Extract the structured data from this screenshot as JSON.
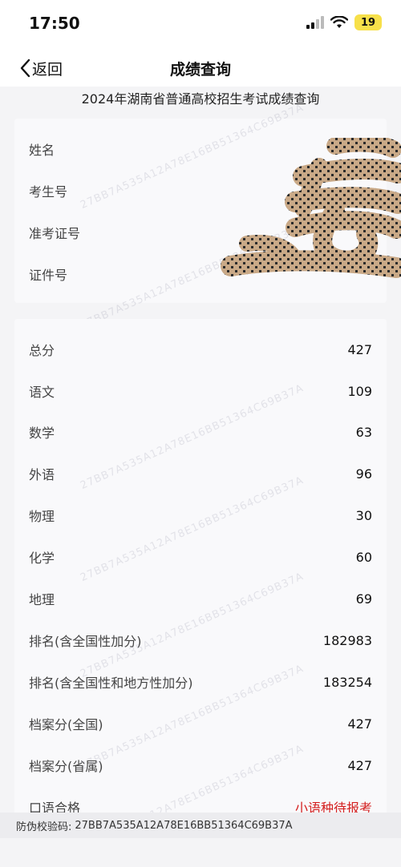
{
  "status_bar": {
    "time": "17:50",
    "battery": "19"
  },
  "nav": {
    "back_label": "返回",
    "title": "成绩查询"
  },
  "subtitle": "2024年湖南省普通高校招生考试成绩查询",
  "personal_info": [
    {
      "label": "姓名"
    },
    {
      "label": "考生号"
    },
    {
      "label": "准考证号"
    },
    {
      "label": "证件号"
    }
  ],
  "scores": [
    {
      "label": "总分",
      "value": "427"
    },
    {
      "label": "语文",
      "value": "109"
    },
    {
      "label": "数学",
      "value": "63"
    },
    {
      "label": "外语",
      "value": "96"
    },
    {
      "label": "物理",
      "value": "30"
    },
    {
      "label": "化学",
      "value": "60"
    },
    {
      "label": "地理",
      "value": "69"
    },
    {
      "label": "排名(含全国性加分)",
      "value": "182983"
    },
    {
      "label": "排名(含全国性和地方性加分)",
      "value": "183254"
    },
    {
      "label": "档案分(全国)",
      "value": "427"
    },
    {
      "label": "档案分(省属)",
      "value": "427"
    },
    {
      "label": "口语合格",
      "value": "小语种待报考"
    }
  ],
  "watermark": "27BB7A535A12A78E16BB51364C69B37A",
  "footer": {
    "label": "防伪校验码:",
    "code": "27BB7A535A12A78E16BB51364C69B37A"
  },
  "colors": {
    "accent_red": "#d42020",
    "battery": "#f7e04a",
    "redaction": "#c9a987"
  }
}
